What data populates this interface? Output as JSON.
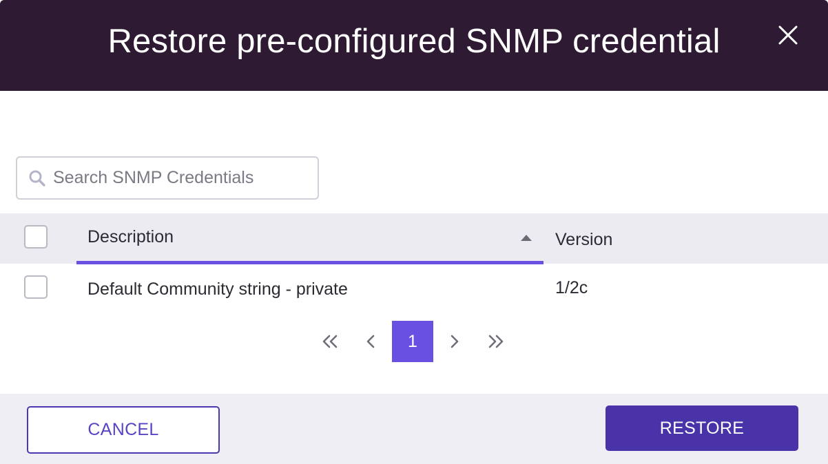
{
  "dialog": {
    "title": "Restore pre-configured SNMP credential"
  },
  "search": {
    "placeholder": "Search SNMP Credentials",
    "value": ""
  },
  "table": {
    "columns": {
      "description": "Description",
      "version": "Version"
    },
    "sort": {
      "column": "description",
      "direction": "ascending"
    },
    "rows": [
      {
        "description": "Default Community string - private",
        "version": "1/2c",
        "checked": false
      }
    ]
  },
  "pagination": {
    "current_page": "1"
  },
  "footer": {
    "cancel_label": "CANCEL",
    "restore_label": "RESTORE"
  },
  "colors": {
    "header_bg": "#2e1a33",
    "accent": "#6a4fe3",
    "primary_button": "#4a32a8"
  },
  "icons": {
    "close": "close-icon",
    "search": "search-icon",
    "sort": "sort-ascending-icon",
    "first": "double-chevron-left-icon",
    "prev": "chevron-left-icon",
    "next": "chevron-right-icon",
    "last": "double-chevron-right-icon"
  }
}
